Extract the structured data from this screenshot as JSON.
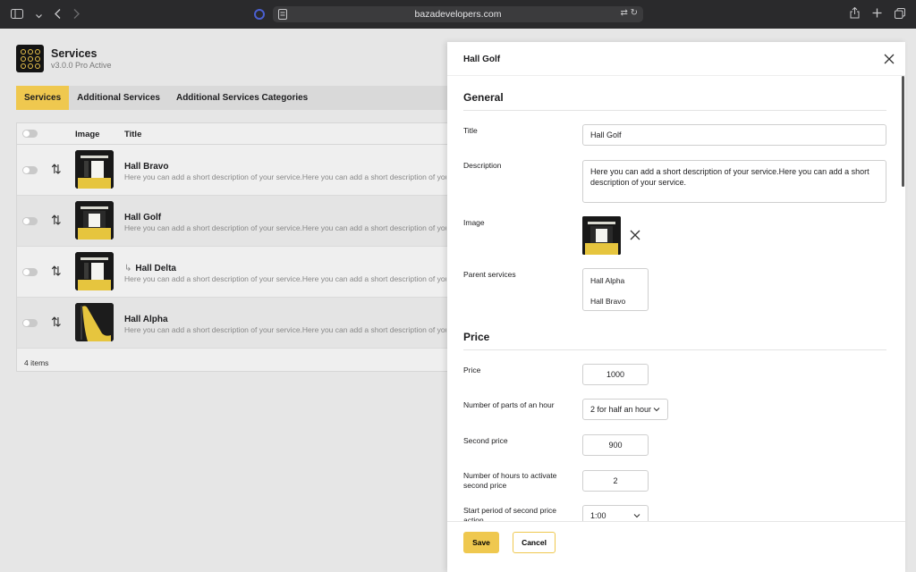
{
  "browser": {
    "url": "bazadevelopers.com"
  },
  "app": {
    "title": "Services",
    "version": "v3.0.0 Pro Active"
  },
  "tabs": [
    {
      "label": "Services"
    },
    {
      "label": "Additional Services"
    },
    {
      "label": "Additional Services Categories"
    }
  ],
  "table": {
    "headers": {
      "image": "Image",
      "title": "Title"
    },
    "rows": [
      {
        "title": "Hall Bravo",
        "description": "Here you can add a short description of your service.Here you can add a short description of your service.",
        "child": false
      },
      {
        "title": "Hall Golf",
        "description": "Here you can add a short description of your service.Here you can add a short description of your service.",
        "child": false
      },
      {
        "title": "Hall Delta",
        "description": "Here you can add a short description of your service.Here you can add a short description of your service.",
        "child": true
      },
      {
        "title": "Hall Alpha",
        "description": "Here you can add a short description of your service.Here you can add a short description of your service.",
        "child": false
      }
    ],
    "footer": "4 items"
  },
  "drawer": {
    "title": "Hall Golf",
    "general_title": "General",
    "fields": {
      "title_label": "Title",
      "title_value": "Hall Golf",
      "description_label": "Description",
      "description_value": "Here you can add a short description of your service.Here you can add a short description of your service.",
      "image_label": "Image",
      "parent_label": "Parent services",
      "parent_options": [
        "Hall Alpha",
        "Hall Bravo"
      ]
    },
    "price_title": "Price",
    "price_fields": {
      "price_label": "Price",
      "price_value": "1000",
      "parts_label": "Number of parts of an hour",
      "parts_value": "2 for half an hour",
      "second_price_label": "Second price",
      "second_price_value": "900",
      "hours_label": "Number of hours to activate second price",
      "hours_value": "2",
      "start_label": "Start period of second price action",
      "start_value": "1:00"
    },
    "save_label": "Save",
    "cancel_label": "Cancel"
  },
  "colors": {
    "accent": "#efc84f",
    "logo_bg": "#141414"
  }
}
